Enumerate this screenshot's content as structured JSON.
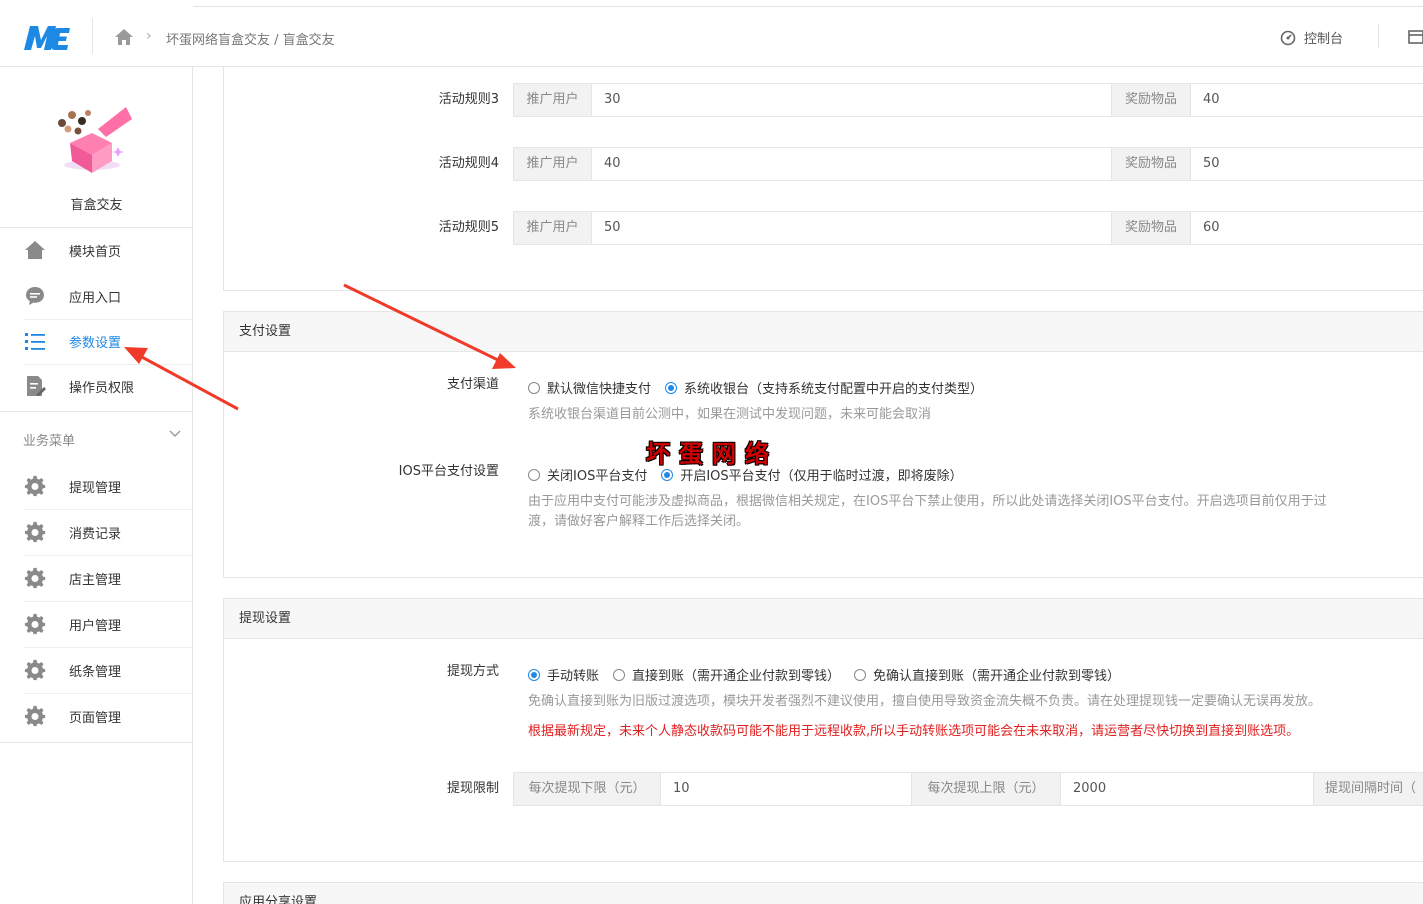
{
  "header": {
    "breadcrumb": "坏蛋网络盲盒交友 / 盲盒交友",
    "console_label": "控制台"
  },
  "sidebar": {
    "module_name": "盲盒交友",
    "nav": [
      {
        "label": "模块首页",
        "icon": "home-icon"
      },
      {
        "label": "应用入口",
        "icon": "chat-icon"
      },
      {
        "label": "参数设置",
        "icon": "list-icon",
        "active": true
      },
      {
        "label": "操作员权限",
        "icon": "edit-doc-icon"
      }
    ],
    "group_label": "业务菜单",
    "business": [
      {
        "label": "提现管理",
        "icon": "gear-icon"
      },
      {
        "label": "消费记录",
        "icon": "gear-icon"
      },
      {
        "label": "店主管理",
        "icon": "gear-icon"
      },
      {
        "label": "用户管理",
        "icon": "gear-icon"
      },
      {
        "label": "纸条管理",
        "icon": "gear-icon"
      },
      {
        "label": "页面管理",
        "icon": "gear-icon"
      }
    ]
  },
  "rules": [
    {
      "label": "活动规则3",
      "promo_addon": "推广用户",
      "promo_value": "30",
      "reward_addon": "奖励物品",
      "reward_value": "40"
    },
    {
      "label": "活动规则4",
      "promo_addon": "推广用户",
      "promo_value": "40",
      "reward_addon": "奖励物品",
      "reward_value": "50"
    },
    {
      "label": "活动规则5",
      "promo_addon": "推广用户",
      "promo_value": "50",
      "reward_addon": "奖励物品",
      "reward_value": "60"
    }
  ],
  "payment": {
    "title": "支付设置",
    "channel_label": "支付渠道",
    "channel_options": [
      "默认微信快捷支付",
      "系统收银台（支持系统支付配置中开启的支付类型）"
    ],
    "channel_selected": 1,
    "channel_help": "系统收银台渠道目前公测中，如果在测试中发现问题，未来可能会取消",
    "ios_label": "IOS平台支付设置",
    "ios_options": [
      "关闭IOS平台支付",
      "开启IOS平台支付（仅用于临时过渡，即将废除）"
    ],
    "ios_selected": 1,
    "ios_help_1": "由于应用中支付可能涉及虚拟商品，根据微信相关规定，在IOS平台下禁止使用，所以此处请选择关闭IOS平台支付。开启选项目前仅用于过",
    "ios_help_2": "渡，请做好客户解释工作后选择关闭。"
  },
  "watermark": "坏蛋网络",
  "withdraw": {
    "title": "提现设置",
    "method_label": "提现方式",
    "method_options": [
      "手动转账",
      "直接到账（需开通企业付款到零钱）",
      "免确认直接到账（需开通企业付款到零钱）"
    ],
    "method_selected": 0,
    "method_help": "免确认直接到账为旧版过渡选项，模块开发者强烈不建议使用，擅自使用导致资金流失概不负责。请在处理提现钱一定要确认无误再发放。",
    "method_warning": "根据最新规定，未来个人静态收款码可能不能用于远程收款,所以手动转账选项可能会在未来取消，请运营者尽快切换到直接到账选项。",
    "limit_label": "提现限制",
    "min_addon": "每次提现下限（元）",
    "min_value": "10",
    "max_addon": "每次提现上限（元）",
    "max_value": "2000",
    "interval_addon": "提现间隔时间（"
  },
  "share": {
    "title": "应用分享设置"
  },
  "colors": {
    "accent": "#1e88e5",
    "warning": "#e02020",
    "arrow": "#f03a2a"
  }
}
